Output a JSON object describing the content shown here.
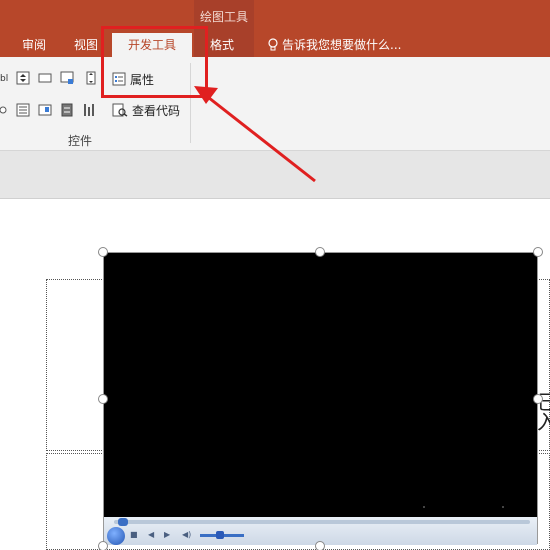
{
  "ribbon": {
    "context_group": "绘图工具",
    "tabs": [
      {
        "label": "审阅"
      },
      {
        "label": "视图"
      },
      {
        "label": "开发工具",
        "active": true
      },
      {
        "label": "格式"
      }
    ],
    "tell_me": "告诉我您想要做什么...",
    "controls_group": {
      "label": "控件",
      "properties": "属性",
      "view_code": "查看代码"
    },
    "left_partial_text": "bl"
  },
  "slide": {
    "side_text": "己入"
  },
  "colors": {
    "ribbon": "#b7472a",
    "annotation": "#e02020",
    "video_bg": "#000000"
  }
}
